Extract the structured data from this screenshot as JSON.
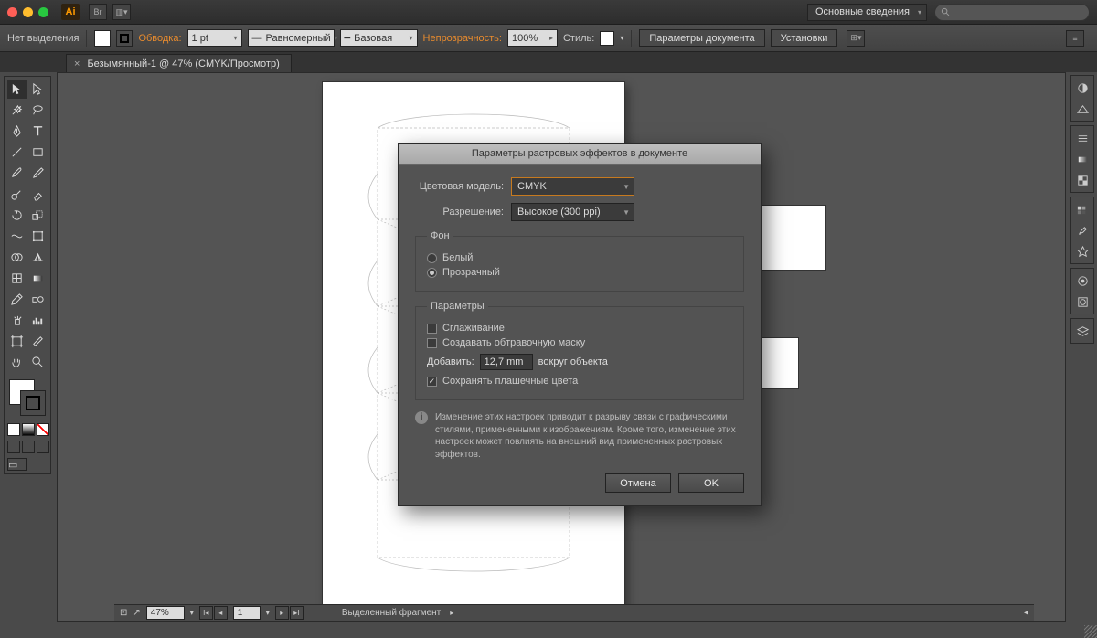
{
  "menubar": {
    "workspace": "Основные сведения"
  },
  "ctrl": {
    "selection": "Нет выделения",
    "stroke_label": "Обводка:",
    "stroke_w": "1 pt",
    "dash": "Равномерный",
    "profile": "Базовая",
    "opacity_label": "Непрозрачность:",
    "opacity": "100%",
    "style_label": "Стиль:",
    "doc_setup": "Параметры документа",
    "prefs": "Установки"
  },
  "tab": "Безымянный-1 @ 47% (CMYK/Просмотр)",
  "dialog": {
    "title": "Параметры растровых эффектов в документе",
    "color_model_label": "Цветовая модель:",
    "color_model": "CMYK",
    "resolution_label": "Разрешение:",
    "resolution": "Высокое (300 ppi)",
    "bg_legend": "Фон",
    "bg_white": "Белый",
    "bg_transparent": "Прозрачный",
    "opts_legend": "Параметры",
    "antialias": "Сглаживание",
    "clip_mask": "Создавать обтравочную маску",
    "add_label": "Добавить:",
    "add_value": "12,7 mm",
    "add_suffix": "вокруг объекта",
    "preserve_spot": "Сохранять плашечные цвета",
    "info": "Изменение этих настроек приводит к разрыву связи с графическими стилями, примененными к изображениям. Кроме того, изменение этих настроек может повлиять на внешний вид примененных растровых эффектов.",
    "cancel": "Отмена",
    "ok": "OK"
  },
  "status": {
    "zoom": "47%",
    "page": "1",
    "frag": "Выделенный фрагмент"
  }
}
